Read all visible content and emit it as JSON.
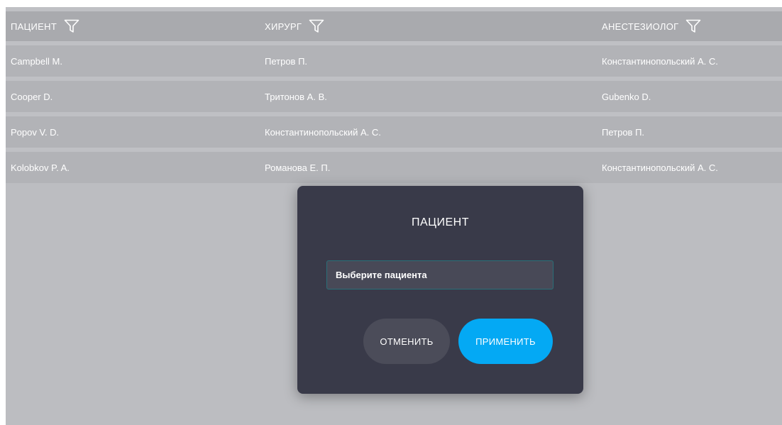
{
  "table": {
    "headers": [
      {
        "label": "ПАЦИЕНТ"
      },
      {
        "label": "ХИРУРГ"
      },
      {
        "label": "АНЕСТЕЗИОЛОГ"
      }
    ],
    "rows": [
      {
        "patient": "Campbell M.",
        "surgeon": "Петров П.",
        "anesthesiologist": "Константинопольский А. С."
      },
      {
        "patient": "Cooper D.",
        "surgeon": "Тритонов А. В.",
        "anesthesiologist": "Gubenko D."
      },
      {
        "patient": "Popov V. D.",
        "surgeon": "Константинопольский А. С.",
        "anesthesiologist": "Петров П."
      },
      {
        "patient": "Kolobkov P. A.",
        "surgeon": "Романова Е. П.",
        "anesthesiologist": "Константинопольский А. С."
      }
    ]
  },
  "modal": {
    "title": "ПАЦИЕНТ",
    "input_value": "",
    "input_placeholder": "Выберите пациента",
    "cancel_label": "ОТМЕНИТЬ",
    "apply_label": "ПРИМЕНИТЬ"
  },
  "colors": {
    "background": "#bcbdc1",
    "header": "#a9aaae",
    "row": "#b2b3b7",
    "modal": "#393a49",
    "accent": "#04a9f4",
    "cancel": "#4b4c59"
  },
  "icons": {
    "filter": "filter-icon"
  }
}
